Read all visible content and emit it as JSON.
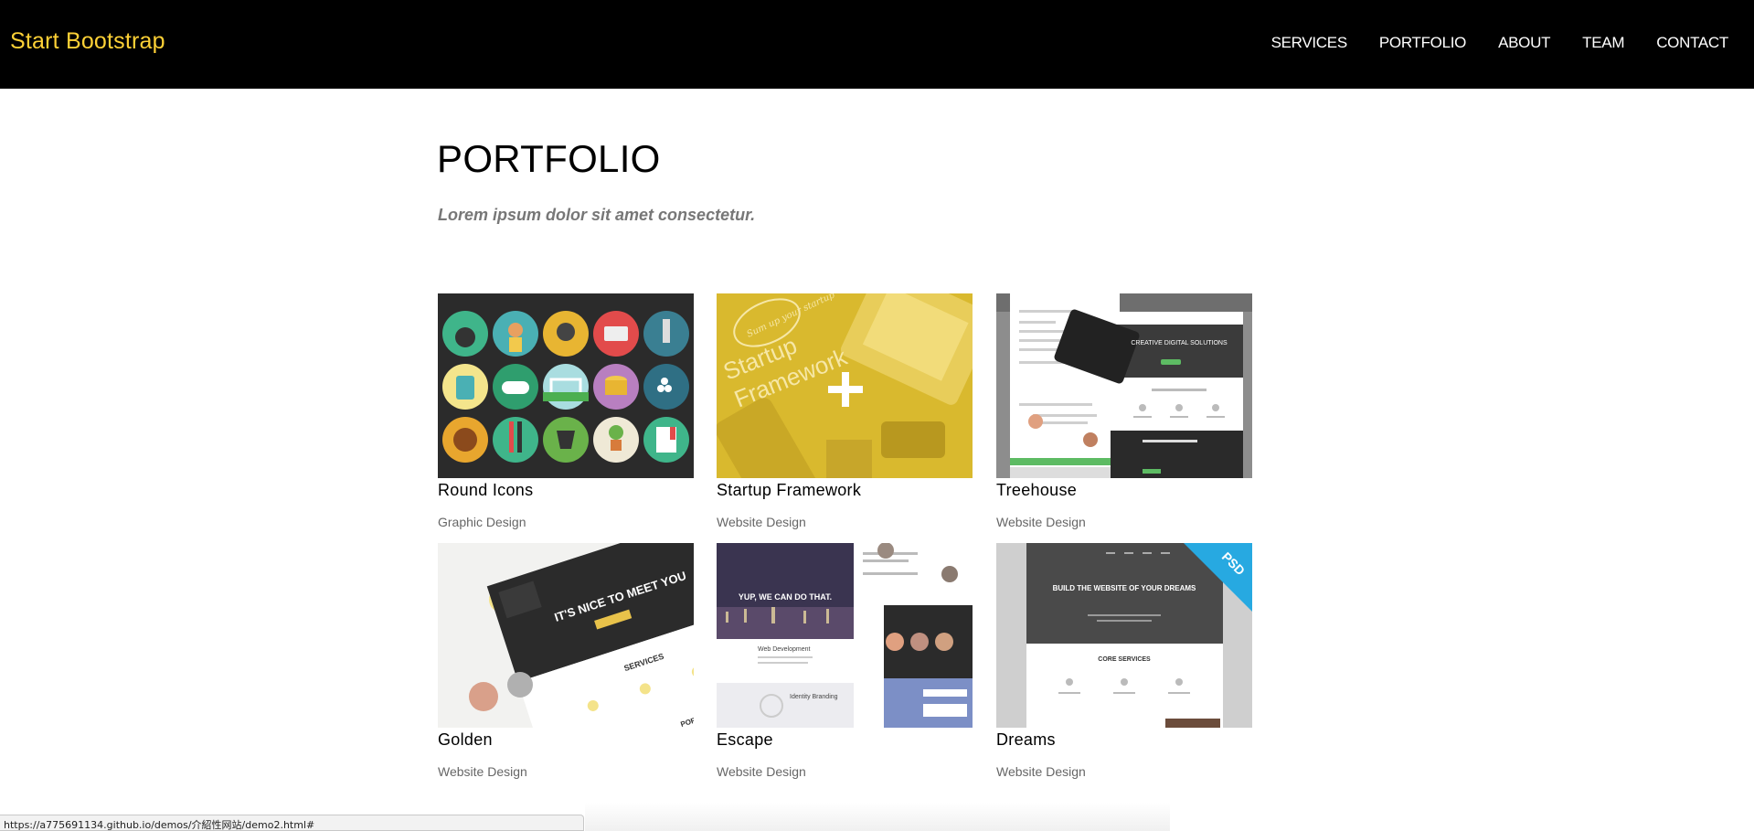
{
  "navbar": {
    "brand": "Start Bootstrap",
    "items": [
      {
        "label": "SERVICES"
      },
      {
        "label": "PORTFOLIO"
      },
      {
        "label": "ABOUT"
      },
      {
        "label": "TEAM"
      },
      {
        "label": "CONTACT"
      }
    ]
  },
  "portfolio": {
    "title": "PORTFOLIO",
    "subtitle": "Lorem ipsum dolor sit amet consectetur.",
    "items": [
      {
        "title": "Round Icons",
        "category": "Graphic Design"
      },
      {
        "title": "Startup Framework",
        "category": "Website Design"
      },
      {
        "title": "Treehouse",
        "category": "Website Design"
      },
      {
        "title": "Golden",
        "category": "Website Design"
      },
      {
        "title": "Escape",
        "category": "Website Design"
      },
      {
        "title": "Dreams",
        "category": "Website Design"
      }
    ],
    "thumb_text": {
      "startup_line1": "Startup",
      "startup_line2": "Framework",
      "startup_badge": "Sum up your startup",
      "treehouse_heading": "CREATIVE DIGITAL SOLUTIONS",
      "golden_heading": "IT'S NICE TO MEET YOU",
      "golden_services": "SERVICES",
      "golden_portfolio": "PORTFOLIO",
      "escape_heading": "YUP, WE CAN DO THAT.",
      "escape_web": "Web Development",
      "escape_branding": "Identity Branding",
      "dreams_heading": "BUILD THE WEBSITE OF YOUR DREAMS",
      "dreams_services": "CORE SERVICES",
      "dreams_badge": "PSD"
    }
  },
  "statusbar": {
    "url": "https://a775691134.github.io/demos/介紹性网站/demo2.html#"
  },
  "colors": {
    "brand": "#fed136",
    "navbar_bg": "#000000",
    "startup_yellow": "#e2c02e",
    "dreams_badge": "#27a9e1"
  }
}
